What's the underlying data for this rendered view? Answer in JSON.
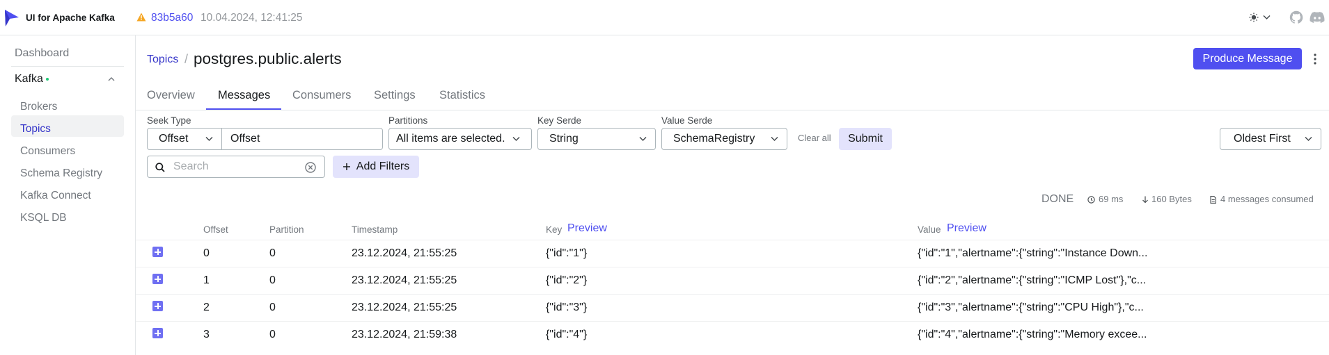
{
  "app": {
    "brand": "UI for Apache Kafka",
    "commit": "83b5a60",
    "commit_date": "10.04.2024, 12:41:25"
  },
  "sidebar": {
    "dashboard": "Dashboard",
    "cluster": "Kafka",
    "items": [
      "Brokers",
      "Topics",
      "Consumers",
      "Schema Registry",
      "Kafka Connect",
      "KSQL DB"
    ],
    "active": "Topics"
  },
  "header": {
    "breadcrumb": "Topics",
    "separator": "/",
    "title": "postgres.public.alerts",
    "produce_label": "Produce Message"
  },
  "tabs": [
    "Overview",
    "Messages",
    "Consumers",
    "Settings",
    "Statistics"
  ],
  "active_tab": "Messages",
  "filters": {
    "seek_type_label": "Seek Type",
    "seek_type": "Offset",
    "offset_placeholder": "Offset",
    "partitions_label": "Partitions",
    "partitions": "All items are selected.",
    "key_serde_label": "Key Serde",
    "key_serde": "String",
    "value_serde_label": "Value Serde",
    "value_serde": "SchemaRegistry",
    "clear_all": "Clear all",
    "submit": "Submit",
    "sort": "Oldest First",
    "search_placeholder": "Search",
    "add_filters": "Add Filters"
  },
  "stats": {
    "status": "DONE",
    "time": "69 ms",
    "bytes": "160 Bytes",
    "consumed": "4 messages consumed"
  },
  "table": {
    "columns": {
      "offset": "Offset",
      "partition": "Partition",
      "timestamp": "Timestamp",
      "key": "Key",
      "value": "Value",
      "preview": "Preview"
    },
    "rows": [
      {
        "offset": "0",
        "partition": "0",
        "timestamp": "23.12.2024, 21:55:25",
        "key": "{\"id\":\"1\"}",
        "value": "{\"id\":\"1\",\"alertname\":{\"string\":\"Instance Down..."
      },
      {
        "offset": "1",
        "partition": "0",
        "timestamp": "23.12.2024, 21:55:25",
        "key": "{\"id\":\"2\"}",
        "value": "{\"id\":\"2\",\"alertname\":{\"string\":\"ICMP Lost\"},\"c..."
      },
      {
        "offset": "2",
        "partition": "0",
        "timestamp": "23.12.2024, 21:55:25",
        "key": "{\"id\":\"3\"}",
        "value": "{\"id\":\"3\",\"alertname\":{\"string\":\"CPU High\"},\"c..."
      },
      {
        "offset": "3",
        "partition": "0",
        "timestamp": "23.12.2024, 21:59:38",
        "key": "{\"id\":\"4\"}",
        "value": "{\"id\":\"4\",\"alertname\":{\"string\":\"Memory excee..."
      }
    ]
  },
  "colors": {
    "accent": "#4f4ff0",
    "active_link": "#3535c9",
    "status_dot": "#1ec875",
    "warning": "#f5a623"
  }
}
